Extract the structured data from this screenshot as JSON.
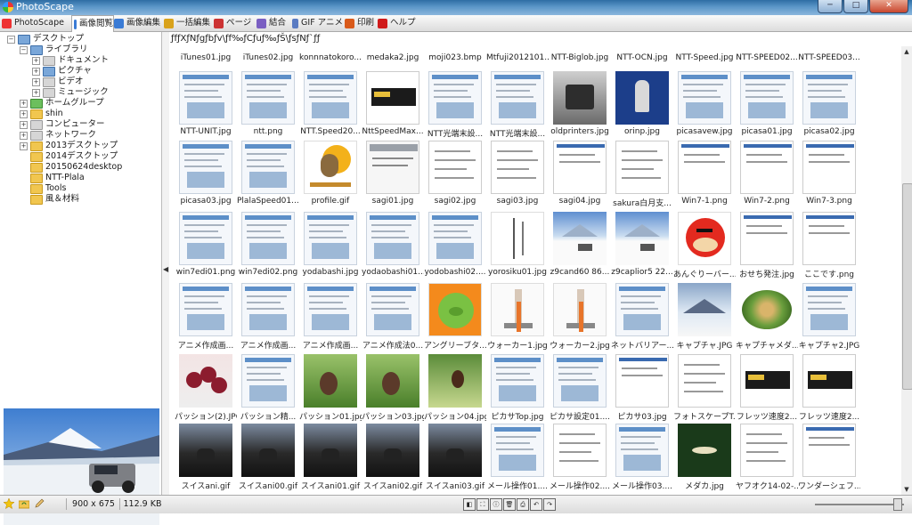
{
  "window": {
    "title": "PhotoScape",
    "min_label": "─",
    "max_label": "□",
    "close_label": "✕"
  },
  "tabs": [
    {
      "label": "PhotoScape",
      "icon": "photoscape-icon",
      "color": "#e33"
    },
    {
      "label": "画像閲覧",
      "icon": "viewer-icon",
      "color": "#3a7bd5"
    },
    {
      "label": "画像編集",
      "icon": "editor-icon",
      "color": "#3a7bd5"
    },
    {
      "label": "一括編集",
      "icon": "batch-icon",
      "color": "#d9a21a"
    },
    {
      "label": "ページ",
      "icon": "page-icon",
      "color": "#c33"
    },
    {
      "label": "結合",
      "icon": "combine-icon",
      "color": "#7a5fc2"
    },
    {
      "label": "GIF アニメ",
      "icon": "gif-icon",
      "color": "#5a7bc2"
    },
    {
      "label": "印刷",
      "icon": "print-icon",
      "color": "#d95a1a"
    },
    {
      "label": "ヘルプ",
      "icon": "help-icon",
      "color": "#d01a1a"
    }
  ],
  "path_text": "ƒfƒXƒNƒgƒbƒv\\ƒf‰ƒCƒuƒ‰ƒŠ\\ƒsƒNƒ`ƒƒ",
  "tree": [
    {
      "label": "デスクトップ",
      "exp": "−",
      "indent": 0,
      "color": "blue"
    },
    {
      "label": "ライブラリ",
      "exp": "−",
      "indent": 1,
      "color": "blue"
    },
    {
      "label": "ドキュメント",
      "exp": "+",
      "indent": 2,
      "color": "gray"
    },
    {
      "label": "ピクチャ",
      "exp": "+",
      "indent": 2,
      "color": "blue"
    },
    {
      "label": "ビデオ",
      "exp": "+",
      "indent": 2,
      "color": "gray"
    },
    {
      "label": "ミュージック",
      "exp": "+",
      "indent": 2,
      "color": "gray"
    },
    {
      "label": "ホームグループ",
      "exp": "+",
      "indent": 1,
      "color": "green"
    },
    {
      "label": "shin",
      "exp": "+",
      "indent": 1,
      "color": "yellow"
    },
    {
      "label": "コンピューター",
      "exp": "+",
      "indent": 1,
      "color": "gray"
    },
    {
      "label": "ネットワーク",
      "exp": "+",
      "indent": 1,
      "color": "gray"
    },
    {
      "label": "2013デスクトップ",
      "exp": "+",
      "indent": 1,
      "color": "yellow"
    },
    {
      "label": "2014デスクトップ",
      "exp": "",
      "indent": 1,
      "color": "yellow"
    },
    {
      "label": "20150624desktop",
      "exp": "",
      "indent": 1,
      "color": "yellow"
    },
    {
      "label": "NTT-Plala",
      "exp": "",
      "indent": 1,
      "color": "yellow"
    },
    {
      "label": "Tools",
      "exp": "",
      "indent": 1,
      "color": "yellow"
    },
    {
      "label": "風＆材料",
      "exp": "",
      "indent": 1,
      "color": "yellow"
    }
  ],
  "top_partial_row": [
    "iTunes01.jpg",
    "iTunes02.jpg",
    "konnnatokoro...",
    "medaka2.jpg",
    "moji023.bmp",
    "Mtfuji2012101...",
    "NTT-Biglob.jpg",
    "NTT-OCN.jpg",
    "NTT-Speed.jpg",
    "NTT-SPEED02...",
    "NTT-SPEED03..."
  ],
  "files": [
    [
      {
        "name": "NTT-UNIT.jpg",
        "t": "shot"
      },
      {
        "name": "ntt.png",
        "t": "shot"
      },
      {
        "name": "NTT.Speed20...",
        "t": "shot"
      },
      {
        "name": "NttSpeedMax...",
        "t": "banner"
      },
      {
        "name": "NTT光端末設...",
        "t": "shot"
      },
      {
        "name": "NTT光端末設...",
        "t": "shot"
      },
      {
        "name": "oldprinters.jpg",
        "t": "gray"
      },
      {
        "name": "orinp.jpg",
        "t": "blue"
      },
      {
        "name": "picasavew.jpg",
        "t": "shot"
      },
      {
        "name": "picasa01.jpg",
        "t": "shot"
      },
      {
        "name": "picasa02.jpg",
        "t": "shot"
      }
    ],
    [
      {
        "name": "picasa03.jpg",
        "t": "shot"
      },
      {
        "name": "PlalaSpeed01....",
        "t": "shot"
      },
      {
        "name": "profile.gif",
        "t": "owl"
      },
      {
        "name": "sagi01.jpg",
        "t": "phone"
      },
      {
        "name": "sagi02.jpg",
        "t": "doc"
      },
      {
        "name": "sagi03.jpg",
        "t": "doc"
      },
      {
        "name": "sagi04.jpg",
        "t": "list"
      },
      {
        "name": "sakura白月支...",
        "t": "doc"
      },
      {
        "name": "Win7-1.png",
        "t": "list"
      },
      {
        "name": "Win7-2.png",
        "t": "list"
      },
      {
        "name": "Win7-3.png",
        "t": "list"
      }
    ],
    [
      {
        "name": "win7edi01.png",
        "t": "shot"
      },
      {
        "name": "win7edi02.png",
        "t": "shot"
      },
      {
        "name": "yodabashi.jpg",
        "t": "shot"
      },
      {
        "name": "yodaobashi01....",
        "t": "shot"
      },
      {
        "name": "yodobashi02....",
        "t": "shot"
      },
      {
        "name": "yorosiku01.jpg",
        "t": "calli"
      },
      {
        "name": "z9cand60 86...",
        "t": "snow"
      },
      {
        "name": "z9caplior5 22...",
        "t": "snow"
      },
      {
        "name": "あんぐりーバー...",
        "t": "bird"
      },
      {
        "name": "おせち発注.jpg",
        "t": "list"
      },
      {
        "name": "ここです.png",
        "t": "list"
      }
    ],
    [
      {
        "name": "アニメ作成画...",
        "t": "shot"
      },
      {
        "name": "アニメ作成画...",
        "t": "shot"
      },
      {
        "name": "アニメ作成画...",
        "t": "shot"
      },
      {
        "name": "アニメ作成法0...",
        "t": "shot"
      },
      {
        "name": "アングリーブタ...",
        "t": "pig"
      },
      {
        "name": "ウォーカー1.jpg",
        "t": "walk"
      },
      {
        "name": "ウォーカー2.jpg",
        "t": "walk"
      },
      {
        "name": "ネットバリアー...",
        "t": "shot"
      },
      {
        "name": "キャプチャ.JPG",
        "t": "photo"
      },
      {
        "name": "キャプチャメダ...",
        "t": "food"
      },
      {
        "name": "キャプチャ2.JPG",
        "t": "shot"
      }
    ],
    [
      {
        "name": "パッション(2).JPG",
        "t": "berry"
      },
      {
        "name": "パッション精...",
        "t": "shot"
      },
      {
        "name": "パッション01.jpg",
        "t": "plant"
      },
      {
        "name": "パッション03.jpg",
        "t": "plant"
      },
      {
        "name": "パッション04.jpg",
        "t": "leaf"
      },
      {
        "name": "ピカサTop.jpg",
        "t": "shot"
      },
      {
        "name": "ピカサ設定01....",
        "t": "shot"
      },
      {
        "name": "ピカサ03.jpg",
        "t": "list"
      },
      {
        "name": "フォトスケープT...",
        "t": "doc"
      },
      {
        "name": "フレッツ速度2...",
        "t": "banner"
      },
      {
        "name": "フレッツ速度2...",
        "t": "banner"
      }
    ],
    [
      {
        "name": "スイスani.gif",
        "t": "dark"
      },
      {
        "name": "スイスani00.gif",
        "t": "dark"
      },
      {
        "name": "スイスani01.gif",
        "t": "dark"
      },
      {
        "name": "スイスani02.gif",
        "t": "dark"
      },
      {
        "name": "スイスani03.gif",
        "t": "dark"
      },
      {
        "name": "メール操作01....",
        "t": "shot"
      },
      {
        "name": "メール操作02....",
        "t": "doc"
      },
      {
        "name": "メール操作03....",
        "t": "shot"
      },
      {
        "name": "メダカ.jpg",
        "t": "fish"
      },
      {
        "name": "ヤフオク14-02-...",
        "t": "doc"
      },
      {
        "name": "ワンダーシェフ...",
        "t": "list"
      }
    ]
  ],
  "status": {
    "dimensions": "900 x 675",
    "filesize": "112.9 KB",
    "left_icons": [
      "star-icon",
      "folder-refresh-icon",
      "pencil-icon"
    ],
    "tool_buttons": [
      {
        "name": "fit-icon",
        "glyph": "◧"
      },
      {
        "name": "fullscreen-icon",
        "glyph": "⛶"
      },
      {
        "name": "info-icon",
        "glyph": "ⓘ"
      },
      {
        "name": "delete-icon",
        "glyph": "🗑"
      },
      {
        "name": "print-icon",
        "glyph": "⎙"
      },
      {
        "name": "rotate-left-icon",
        "glyph": "↶"
      },
      {
        "name": "rotate-right-icon",
        "glyph": "↷"
      }
    ]
  },
  "thumbnail_zoom_fraction": 0.92
}
